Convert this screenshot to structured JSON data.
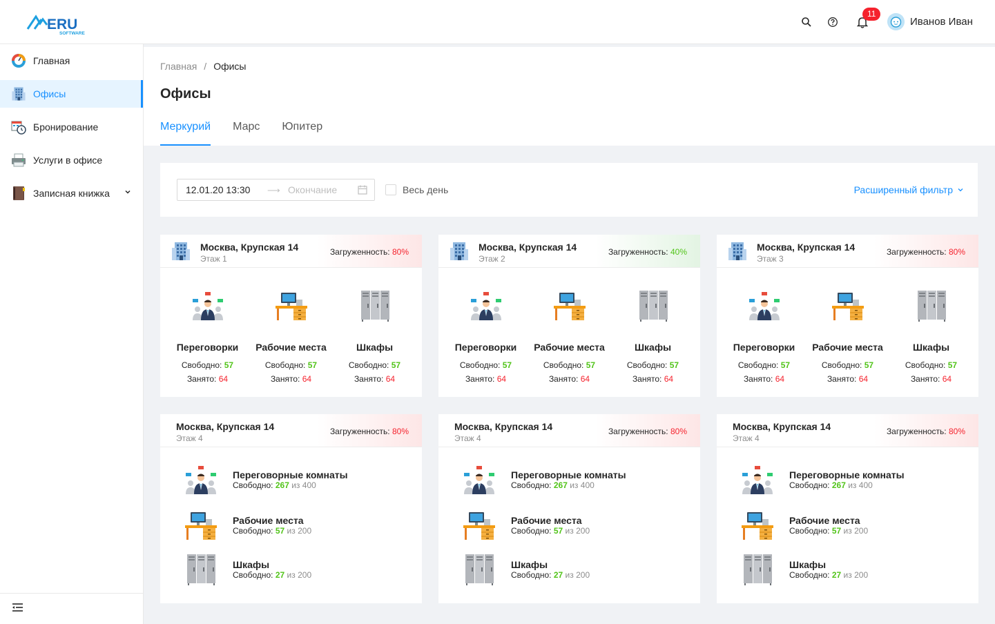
{
  "header": {
    "user_name": "Иванов Иван",
    "notification_count": "11",
    "icons": [
      "search-icon",
      "help-icon",
      "bell-icon"
    ]
  },
  "sidebar": {
    "items": [
      {
        "label": "Главная",
        "icon": "dashboard-icon"
      },
      {
        "label": "Офисы",
        "icon": "building-icon",
        "active": true
      },
      {
        "label": "Бронирование",
        "icon": "booking-icon"
      },
      {
        "label": "Услуги в офисе",
        "icon": "printer-icon"
      },
      {
        "label": "Записная книжка",
        "icon": "notebook-icon",
        "expandable": true
      }
    ]
  },
  "breadcrumb": {
    "root": "Главная",
    "sep": "/",
    "current": "Офисы"
  },
  "page_title": "Офисы",
  "tabs": [
    "Меркурий",
    "Марс",
    "Юпитер"
  ],
  "filter": {
    "start": "12.01.20 13:30",
    "end_placeholder": "Окончание",
    "all_day": "Весь день",
    "advanced": "Расширенный фильтр"
  },
  "labels": {
    "load": "Загруженность: ",
    "free": "Свободно: ",
    "busy": "Занято: ",
    "of": "из"
  },
  "cards_top": [
    {
      "address": "Москва, Крупская 14",
      "floor": "Этаж 1",
      "load": "80%",
      "status": "red",
      "cols": [
        {
          "name": "Переговорки",
          "free": "57",
          "busy": "64"
        },
        {
          "name": "Рабочие места",
          "free": "57",
          "busy": "64"
        },
        {
          "name": "Шкафы",
          "free": "57",
          "busy": "64"
        }
      ]
    },
    {
      "address": "Москва, Крупская 14",
      "floor": "Этаж 2",
      "load": "40%",
      "status": "green",
      "cols": [
        {
          "name": "Переговорки",
          "free": "57",
          "busy": "64"
        },
        {
          "name": "Рабочие места",
          "free": "57",
          "busy": "64"
        },
        {
          "name": "Шкафы",
          "free": "57",
          "busy": "64"
        }
      ]
    },
    {
      "address": "Москва, Крупская 14",
      "floor": "Этаж 3",
      "load": "80%",
      "status": "red",
      "cols": [
        {
          "name": "Переговорки",
          "free": "57",
          "busy": "64"
        },
        {
          "name": "Рабочие места",
          "free": "57",
          "busy": "64"
        },
        {
          "name": "Шкафы",
          "free": "57",
          "busy": "64"
        }
      ]
    }
  ],
  "cards_bottom": [
    {
      "address": "Москва, Крупская 14",
      "floor": "Этаж 4",
      "load": "80%",
      "status": "red",
      "rows": [
        {
          "name": "Переговорные комнаты",
          "free": "267",
          "total": "400"
        },
        {
          "name": "Рабочие места",
          "free": "57",
          "total": "200"
        },
        {
          "name": "Шкафы",
          "free": "27",
          "total": "200"
        }
      ]
    },
    {
      "address": "Москва, Крупская 14",
      "floor": "Этаж 4",
      "load": "80%",
      "status": "red",
      "rows": [
        {
          "name": "Переговорные комнаты",
          "free": "267",
          "total": "400"
        },
        {
          "name": "Рабочие места",
          "free": "57",
          "total": "200"
        },
        {
          "name": "Шкафы",
          "free": "27",
          "total": "200"
        }
      ]
    },
    {
      "address": "Москва, Крупская 14",
      "floor": "Этаж 4",
      "load": "80%",
      "status": "red",
      "rows": [
        {
          "name": "Переговорные комнаты",
          "free": "267",
          "total": "400"
        },
        {
          "name": "Рабочие места",
          "free": "57",
          "total": "200"
        },
        {
          "name": "Шкафы",
          "free": "27",
          "total": "200"
        }
      ]
    }
  ],
  "colors": {
    "accent": "#1890ff",
    "free": "#52c41a",
    "busy": "#f5222d"
  }
}
